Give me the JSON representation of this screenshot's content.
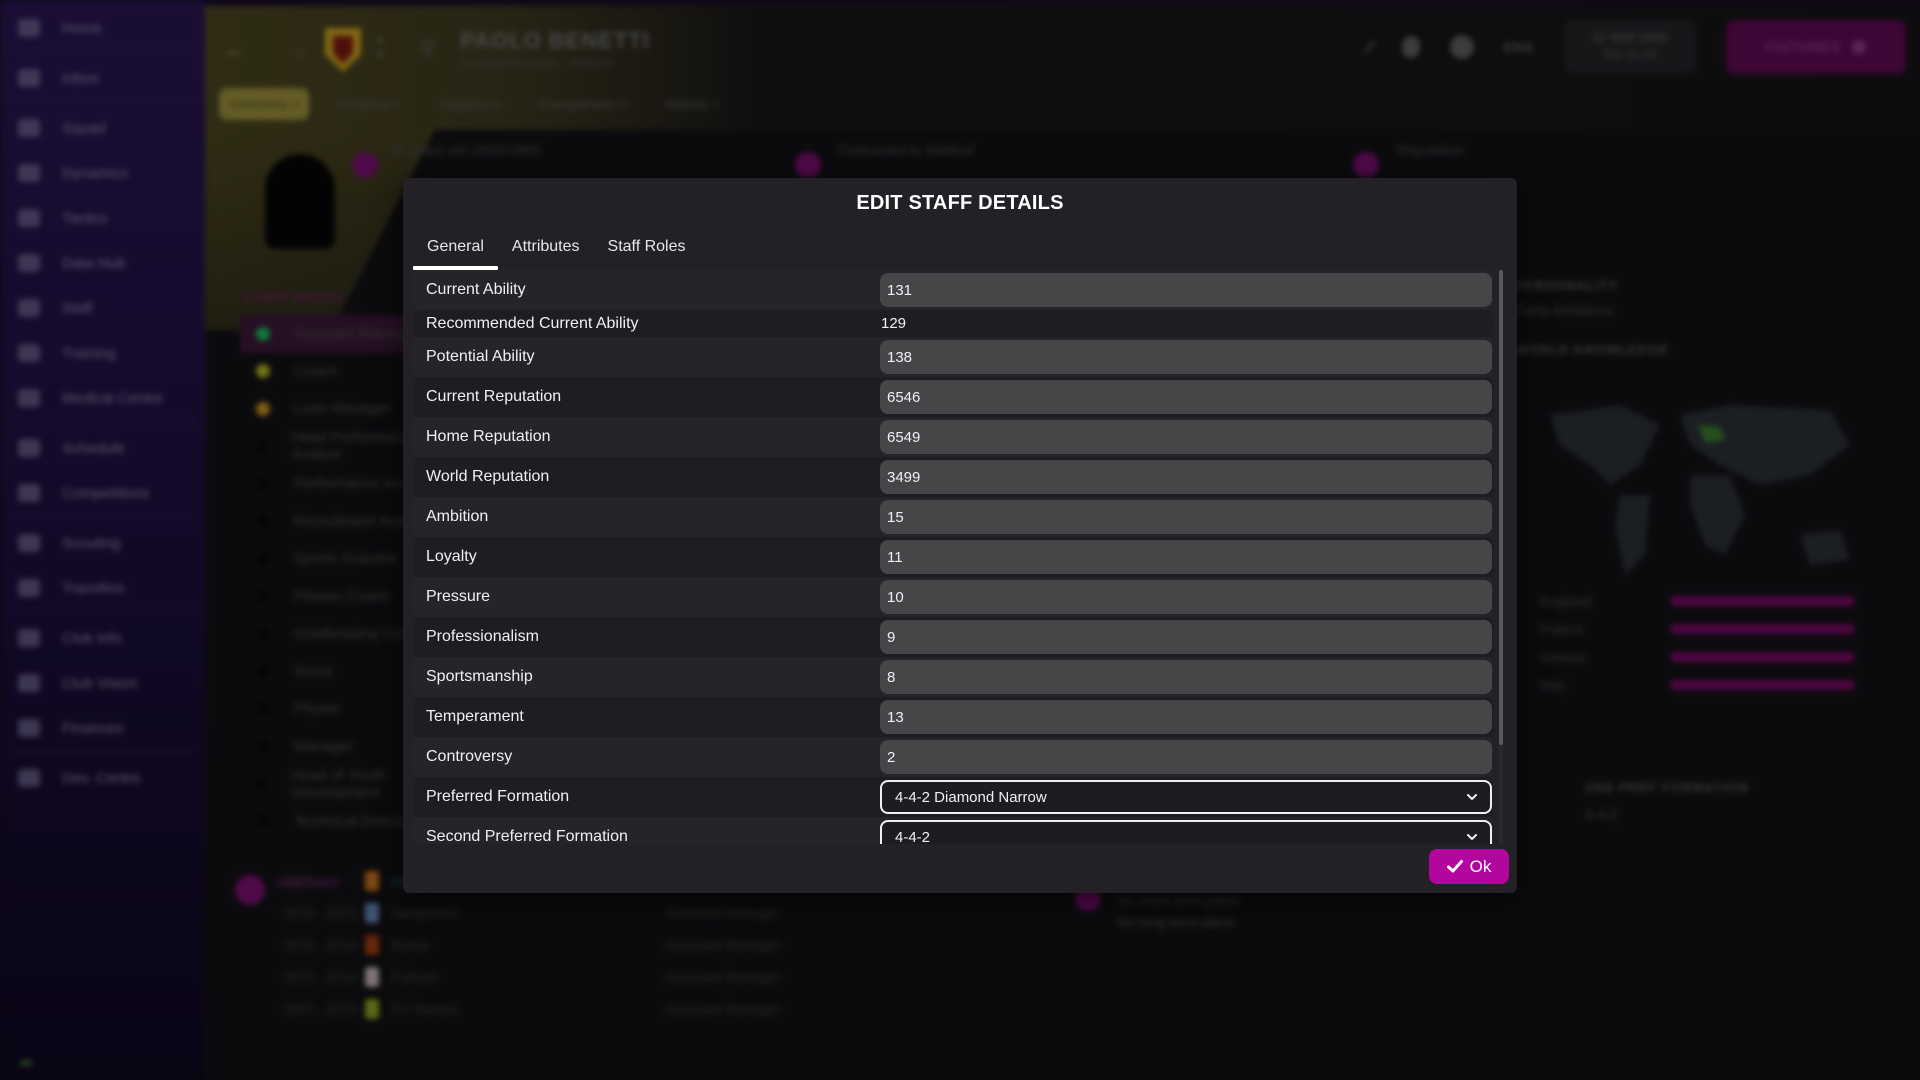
{
  "background": {
    "sidebar": {
      "items": [
        {
          "label": "Home",
          "icon": "home-icon"
        },
        {
          "label": "Inbox",
          "icon": "inbox-icon"
        },
        {
          "label": "Squad",
          "icon": "shirt-icon"
        },
        {
          "label": "Dynamics",
          "icon": "dynamics-icon"
        },
        {
          "label": "Tactics",
          "icon": "tactics-icon"
        },
        {
          "label": "Data Hub",
          "icon": "data-hub-icon"
        },
        {
          "label": "Staff",
          "icon": "staff-icon"
        },
        {
          "label": "Training",
          "icon": "training-icon"
        },
        {
          "label": "Medical Centre",
          "icon": "medical-icon"
        },
        {
          "label": "Schedule",
          "icon": "calendar-icon"
        },
        {
          "label": "Competitions",
          "icon": "trophy-icon"
        },
        {
          "label": "Scouting",
          "icon": "search-icon"
        },
        {
          "label": "Transfers",
          "icon": "transfers-icon"
        },
        {
          "label": "Club Info",
          "icon": "shield-icon"
        },
        {
          "label": "Club Vision",
          "icon": "vision-icon"
        },
        {
          "label": "Finances",
          "icon": "finances-icon"
        },
        {
          "label": "Dev. Centre",
          "icon": "dev-centre-icon"
        }
      ]
    },
    "topbar": {
      "person_name": "PAOLO BENETTI",
      "person_subtitle": "Assistant Manager - Watford",
      "tabs": [
        "Overview",
        "Contract",
        "Reports",
        "Comparison",
        "History"
      ],
      "date": "11 SEP 2020",
      "day_time": "Sat 11:00",
      "fixtures_label": "FIXTURES",
      "lang": "ENG"
    },
    "info_cards": [
      {
        "title": "56 years old (28/4/1965)"
      },
      {
        "title": "Contracted to Watford"
      },
      {
        "title": "Reputation"
      }
    ],
    "staff_roles_title": "STAFF ROLES",
    "staff_roles": [
      {
        "label": "Assistant Manager",
        "color": "#1db954"
      },
      {
        "label": "Coach",
        "color": "#b0b020"
      },
      {
        "label": "Loan Manager",
        "color": "#c09020"
      },
      {
        "label": "Head Performance Analyst",
        "color": "#0a0a0a"
      },
      {
        "label": "Performance Analyst",
        "color": "#0a0a0a"
      },
      {
        "label": "Recruitment Analyst",
        "color": "#0a0a0a"
      },
      {
        "label": "Sports Scientist",
        "color": "#0a0a0a"
      },
      {
        "label": "Fitness Coach",
        "color": "#0a0a0a"
      },
      {
        "label": "Goalkeeping Coach",
        "color": "#0a0a0a"
      },
      {
        "label": "Scout",
        "color": "#0a0a0a"
      },
      {
        "label": "Physio",
        "color": "#0a0a0a"
      },
      {
        "label": "Manager",
        "color": "#0a0a0a"
      },
      {
        "label": "Head of Youth Development",
        "color": "#0a0a0a"
      },
      {
        "label": "Technical Director",
        "color": "#0a0a0a"
      }
    ],
    "personality_title": "PERSONALITY",
    "personality_value": "Fairly Ambitious",
    "world_knowledge_title": "WORLD KNOWLEDGE",
    "nation_knowledge": [
      {
        "label": "England",
        "value": 1.0
      },
      {
        "label": "France",
        "value": 1.0
      },
      {
        "label": "Greece",
        "value": 1.0
      },
      {
        "label": "Italy",
        "value": 1.0
      }
    ],
    "second_formation_title": "2ND PREF FORMATION",
    "second_formation_value": "4-4-2",
    "history_title": "HISTORY",
    "history": [
      {
        "years": "2021 -",
        "club": "Watford",
        "role": "Assistant Manager",
        "badge": "#c07018"
      },
      {
        "years": "2019 - 2021",
        "club": "Sampdoria",
        "role": "Assistant Manager",
        "badge": "#6080b0"
      },
      {
        "years": "2016 - 2019",
        "club": "Roma",
        "role": "Assistant Manager",
        "badge": "#a03a10"
      },
      {
        "years": "2015 - 2016",
        "club": "Fulham",
        "role": "Assistant Manager",
        "badge": "#c0b0b0"
      },
      {
        "years": "2007 - 2015",
        "club": "FC Nantes",
        "role": "Assistant Manager",
        "badge": "#8aa020"
      }
    ],
    "plans": [
      "No short term plans",
      "No long term plans"
    ]
  },
  "modal": {
    "title": "EDIT STAFF DETAILS",
    "tabs": [
      {
        "label": "General",
        "active": true
      },
      {
        "label": "Attributes",
        "active": false
      },
      {
        "label": "Staff Roles",
        "active": false
      }
    ],
    "fields": [
      {
        "label": "Current Ability",
        "type": "input",
        "value": "131"
      },
      {
        "label": "Recommended Current Ability",
        "type": "static",
        "value": "129"
      },
      {
        "label": "Potential Ability",
        "type": "input",
        "value": "138"
      },
      {
        "label": "Current Reputation",
        "type": "input",
        "value": "6546"
      },
      {
        "label": "Home Reputation",
        "type": "input",
        "value": "6549"
      },
      {
        "label": "World Reputation",
        "type": "input",
        "value": "3499"
      },
      {
        "label": "Ambition",
        "type": "input",
        "value": "15"
      },
      {
        "label": "Loyalty",
        "type": "input",
        "value": "11"
      },
      {
        "label": "Pressure",
        "type": "input",
        "value": "10"
      },
      {
        "label": "Professionalism",
        "type": "input",
        "value": "9"
      },
      {
        "label": "Sportsmanship",
        "type": "input",
        "value": "8"
      },
      {
        "label": "Temperament",
        "type": "input",
        "value": "13"
      },
      {
        "label": "Controversy",
        "type": "input",
        "value": "2"
      },
      {
        "label": "Preferred Formation",
        "type": "select",
        "value": "4-4-2 Diamond Narrow"
      },
      {
        "label": "Second Preferred Formation",
        "type": "select",
        "value": "4-4-2"
      }
    ],
    "scroll_position": 0.0,
    "ok_label": "Ok",
    "accent_color": "#b3069f"
  }
}
